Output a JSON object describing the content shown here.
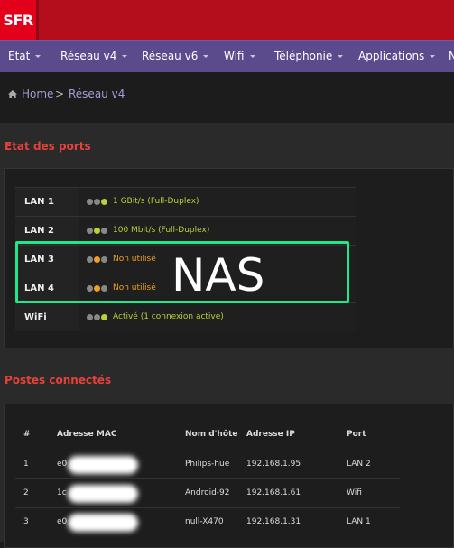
{
  "brand": {
    "logo_text": "SFR",
    "color": "#e2001a"
  },
  "nav": {
    "items": [
      {
        "label": "Etat",
        "has_menu": true
      },
      {
        "label": "Réseau v4",
        "has_menu": true
      },
      {
        "label": "Réseau v6",
        "has_menu": true
      },
      {
        "label": "Wifi",
        "has_menu": true
      },
      {
        "label": "Téléphonie",
        "has_menu": true
      },
      {
        "label": "Applications",
        "has_menu": true
      },
      {
        "label": "N",
        "has_menu": false
      }
    ]
  },
  "breadcrumb": {
    "home_icon": "home-icon",
    "home": "Home",
    "separator": ">",
    "current": "Réseau v4"
  },
  "ports": {
    "title": "Etat des ports",
    "rows": [
      {
        "label": "LAN 1",
        "status": "1 GBit/s (Full-Duplex)",
        "dots": [
          "#888888",
          "#888888",
          "#b6d236"
        ],
        "status_color": "#b6d236"
      },
      {
        "label": "LAN 2",
        "status": "100 Mbit/s (Full-Duplex)",
        "dots": [
          "#888888",
          "#b6d236",
          "#888888"
        ],
        "status_color": "#b6d236"
      },
      {
        "label": "LAN 3",
        "status": "Non utilisé",
        "dots": [
          "#888888",
          "#f0a020",
          "#888888"
        ],
        "status_color": "#f0a020"
      },
      {
        "label": "LAN 4",
        "status": "Non utilisé",
        "dots": [
          "#888888",
          "#f0a020",
          "#888888"
        ],
        "status_color": "#f0a020"
      },
      {
        "label": "WiFi",
        "status": "Activé (1 connexion active)",
        "dots": [
          "#888888",
          "#888888",
          "#b6d236"
        ],
        "status_color": "#b6d236"
      }
    ],
    "annotation": "NAS",
    "annotation_color": "#1ee88a"
  },
  "hosts": {
    "title": "Postes connectés",
    "headers": [
      "#",
      "Adresse MAC",
      "Nom d'hôte",
      "Adresse IP",
      "Port"
    ],
    "rows": [
      {
        "num": "1",
        "mac": "e0",
        "hostname": "Philips-hue",
        "ip": "192.168.1.95",
        "port": "LAN 2"
      },
      {
        "num": "2",
        "mac": "1c",
        "hostname": "Android-92",
        "ip": "192.168.1.61",
        "port": "Wifi"
      },
      {
        "num": "3",
        "mac": "e0",
        "hostname": "null-X470",
        "ip": "192.168.1.31",
        "port": "LAN 1"
      }
    ]
  }
}
